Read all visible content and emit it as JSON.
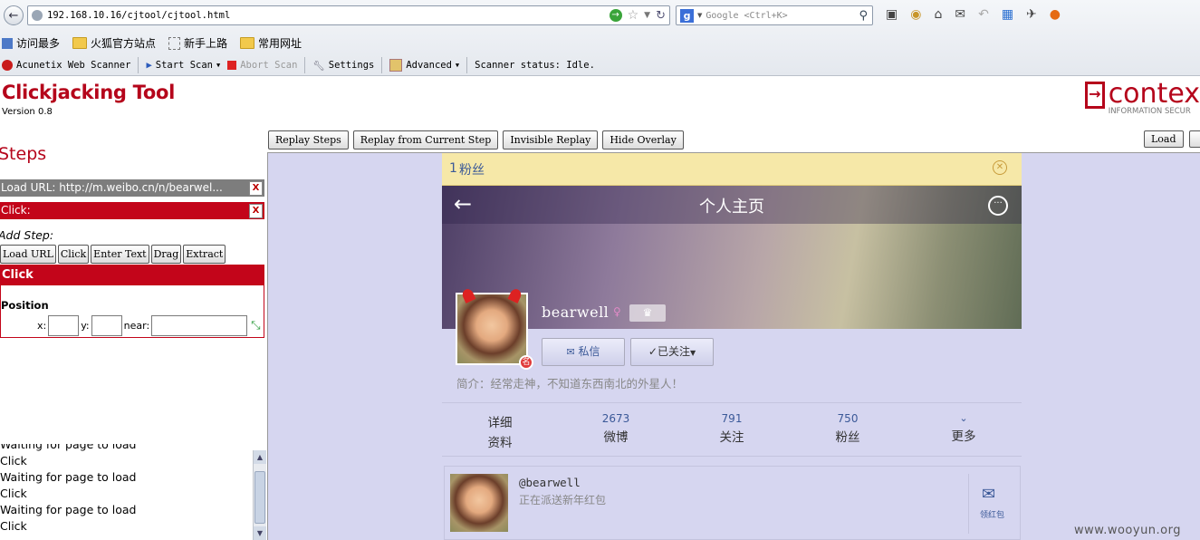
{
  "browser": {
    "url": "192.168.10.16/cjtool/cjtool.html",
    "search_placeholder": "Google <Ctrl+K>",
    "bookmarks": [
      "访问最多",
      "火狐官方站点",
      "新手上路",
      "常用网址"
    ],
    "toolbar": {
      "brand": "Acunetix Web Scanner",
      "start_scan": "Start Scan",
      "abort_scan": "Abort Scan",
      "settings": "Settings",
      "advanced": "Advanced",
      "status": "Scanner status: Idle."
    }
  },
  "tool": {
    "title": "Clickjacking Tool",
    "version": "Version 0.8",
    "logo_text": "contex",
    "logo_sub": "INFORMATION SECUR",
    "steps_heading": "Steps",
    "steps": [
      {
        "label": "Load URL: http://m.weibo.cn/n/bearwel..."
      },
      {
        "label": "Click:"
      }
    ],
    "add_step_label": "Add Step:",
    "add_buttons": [
      "Load URL",
      "Click",
      "Enter Text",
      "Drag",
      "Extract"
    ],
    "editor_title": "Click",
    "position_label": "Position",
    "x_label": "x:",
    "y_label": "y:",
    "near_label": "near:",
    "x_value": "",
    "y_value": "",
    "near_value": "",
    "controls": [
      "Replay Steps",
      "Replay from Current Step",
      "Invisible Replay",
      "Hide Overlay"
    ],
    "load_button": "Load",
    "log": [
      "Waiting for page to load",
      "Click",
      "Waiting for page to load",
      "Click",
      "Waiting for page to load",
      "Click"
    ]
  },
  "weibo": {
    "notice_count": "1",
    "notice_text": "粉丝",
    "header_title": "个人主页",
    "username": "bearwell",
    "message_button": "私信",
    "followed_button": "已关注",
    "bio": "简介：经常走神，不知道东西南北的外星人！",
    "stats": [
      {
        "num": "详细",
        "label": "资料"
      },
      {
        "num": "2673",
        "label": "微博"
      },
      {
        "num": "791",
        "label": "关注"
      },
      {
        "num": "750",
        "label": "粉丝"
      },
      {
        "num": "",
        "label": "更多"
      }
    ],
    "post_user": "@bearwell",
    "post_text": "正在派送新年红包",
    "post_action": "领红包"
  },
  "watermark": "www.wooyun.org",
  "colors": {
    "brand_red": "#b5051b",
    "step_gray": "#7d7d7d",
    "overlay": "#d6d6f0",
    "link_blue": "#3b5998"
  }
}
